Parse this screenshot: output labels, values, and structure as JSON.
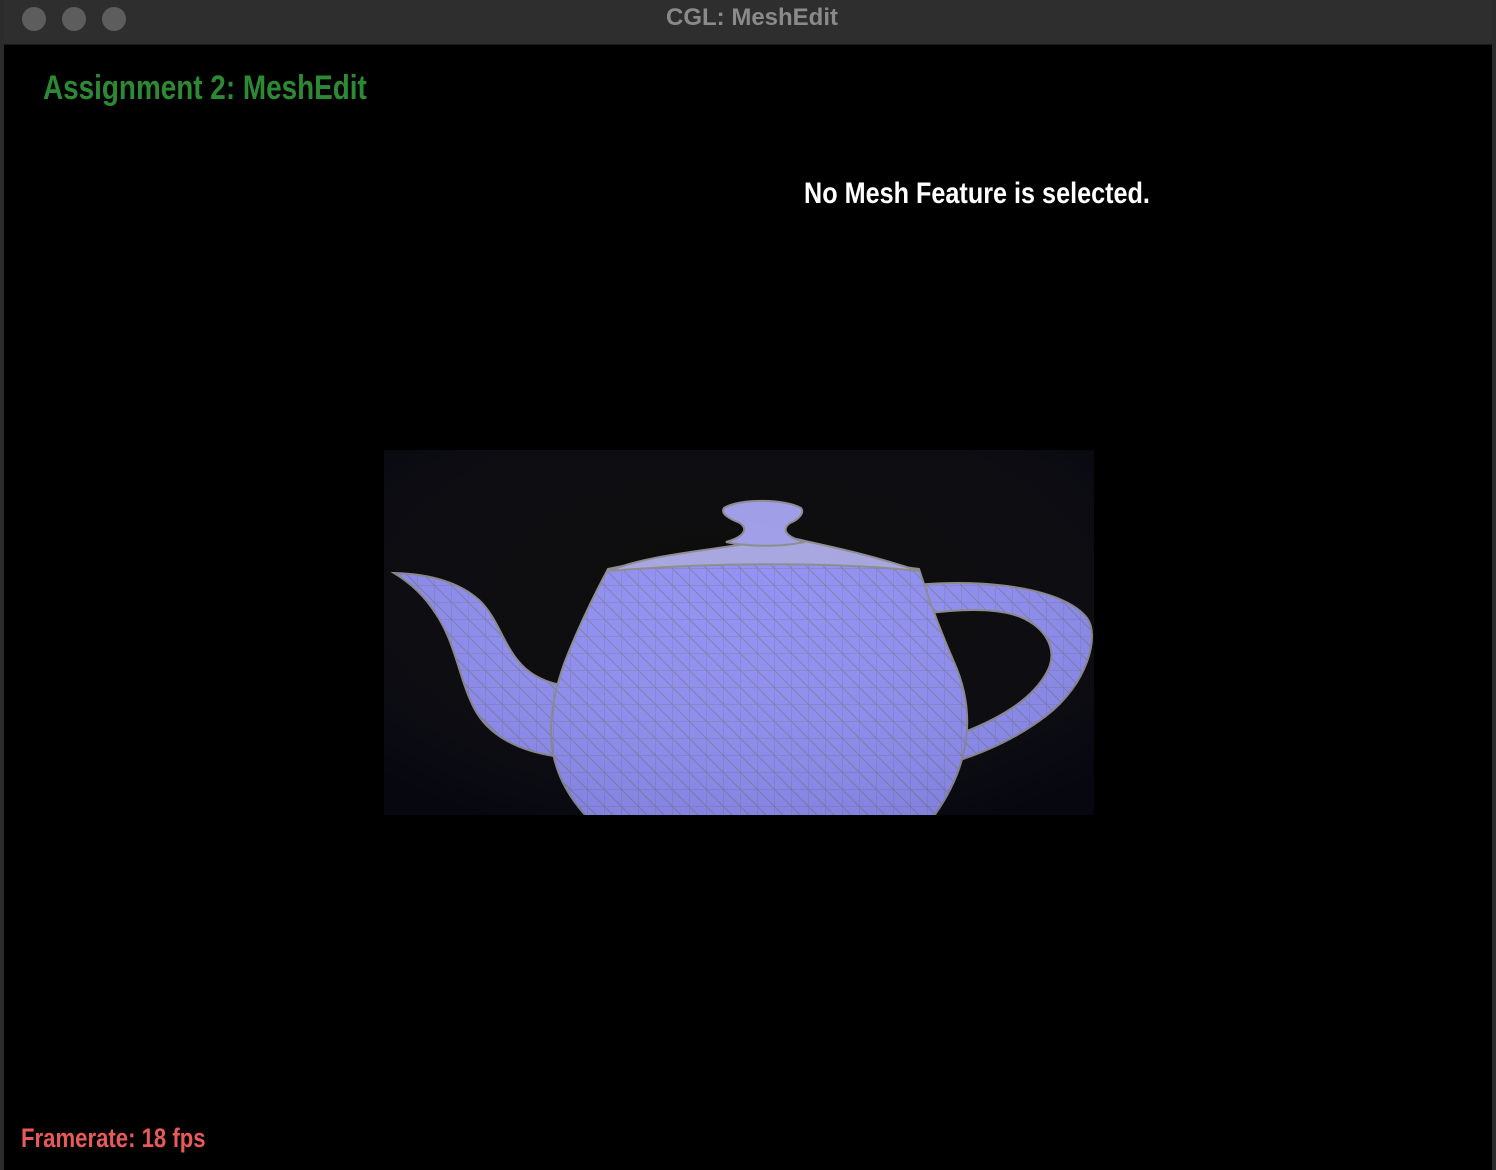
{
  "window": {
    "title": "CGL: MeshEdit",
    "buttons": [
      "close",
      "minimize",
      "maximize"
    ]
  },
  "overlay": {
    "assignment_title": "Assignment 2: MeshEdit",
    "selection_status": "No Mesh Feature is selected.",
    "framerate": "Framerate: 18 fps"
  },
  "scene": {
    "model": "teapot",
    "render_mode": "wireframe over shaded",
    "colors": {
      "mesh_fill": "#8f8df2",
      "mesh_edge": "#8b8b8b",
      "background": "#000000",
      "title": "#2d8a34",
      "framerate": "#e85a5a",
      "status": "#ffffff"
    }
  }
}
